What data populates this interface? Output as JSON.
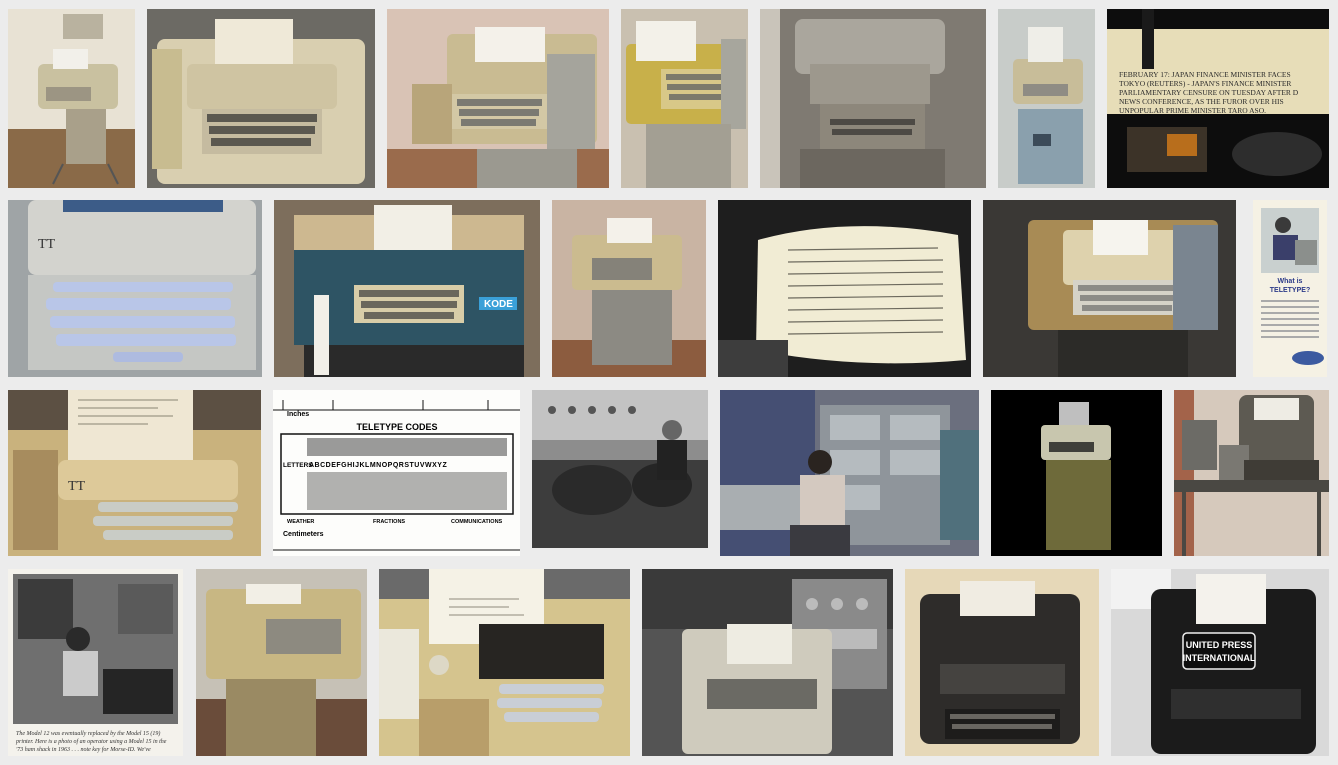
{
  "gallery": {
    "tiles": [
      {
        "name": "teletype-on-stand-beige"
      },
      {
        "name": "teletype-beige-keyboard-closeup"
      },
      {
        "name": "teletype-with-tape-reader"
      },
      {
        "name": "teletype-yellow-model"
      },
      {
        "name": "teletype-museum-gray"
      },
      {
        "name": "teletype-blue-stand"
      },
      {
        "name": "teletype-printing-mechanism"
      },
      {
        "name": "teletype-keyboard-blue-keys"
      },
      {
        "name": "teletype-green-console-kode"
      },
      {
        "name": "teletype-on-stand-brown-room"
      },
      {
        "name": "teletype-paper-roll-printout"
      },
      {
        "name": "teletype-asr33-dark"
      },
      {
        "name": "teletype-advertisement-leaflet"
      },
      {
        "name": "teletype-paper-printout-closeup"
      },
      {
        "name": "teletype-codes-card"
      },
      {
        "name": "teletype-operators-bw-photo"
      },
      {
        "name": "teletype-ham-radio-station"
      },
      {
        "name": "teletype-on-black-background"
      },
      {
        "name": "teletype-model15-on-desk"
      },
      {
        "name": "teletype-operator-woman-bw"
      },
      {
        "name": "teletype-on-stand-tiled-floor"
      },
      {
        "name": "teletype-asr33-tape-closeup"
      },
      {
        "name": "teletype-radio-room"
      },
      {
        "name": "teletype-model15-vintage"
      },
      {
        "name": "teletype-united-press-international"
      }
    ],
    "texts": {
      "wire_line1": "FEBRUARY 17: JAPAN FINANCE MINISTER FACES",
      "wire_line2": "TOKYO (REUTERS) - JAPAN'S FINANCE MINISTER",
      "wire_line3": "PARLIAMENTARY CENSURE ON TUESDAY AFTER D",
      "wire_line4": "NEWS CONFERENCE, AS THE FUROR OVER HIS",
      "wire_line5": "UNPOPULAR PRIME MINISTER TARO ASO.",
      "kode_label": "KODE",
      "ad_title1": "What is",
      "ad_title2": "TELETYPE?",
      "codes_inches": "Inches",
      "codes_title": "TELETYPE CODES",
      "codes_letters": "LETTERS",
      "codes_alphabet": "ABCDEFGHIJKLMNOPQRSTUVWXYZ",
      "codes_weather": "WEATHER",
      "codes_fractions": "FRACTIONS",
      "codes_comms": "COMMUNICATIONS",
      "codes_cm": "Centimeters",
      "caption_l1": "The Model 12 was eventually replaced by the Model 15 (19)",
      "caption_l2": "printer. Here is a photo of an operator using a Model 15 in the",
      "caption_l3": "'73 ham shack in 1963 . . . note key for Morse-ID. We've",
      "upi_l1": "UNITED PRESS",
      "upi_l2": "INTERNATIONAL"
    },
    "colors": {
      "background": "#ececec",
      "beige": "#d8c9a0",
      "tan": "#b59a63",
      "dark": "#1a1a1a"
    }
  }
}
